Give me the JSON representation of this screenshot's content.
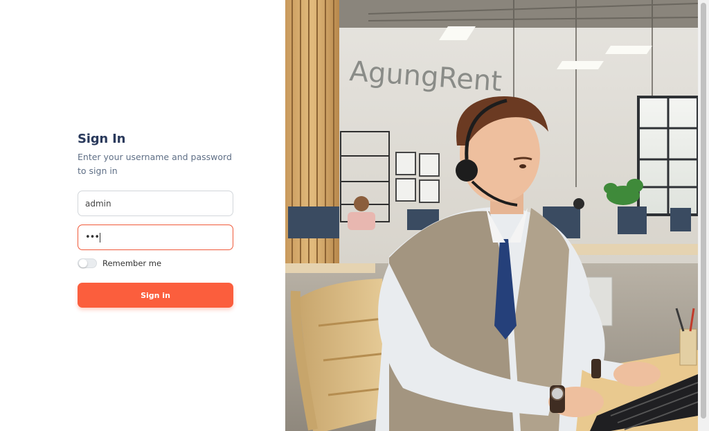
{
  "signin": {
    "title": "Sign In",
    "subtitle": "Enter your username and password to sign in",
    "username_value": "admin",
    "password_mask": "•••",
    "remember_label": "Remember me",
    "remember_checked": false,
    "button_label": "Sign in",
    "accent_color": "#fb5e3d"
  },
  "illustration": {
    "brand_sign": "AgungRent"
  }
}
